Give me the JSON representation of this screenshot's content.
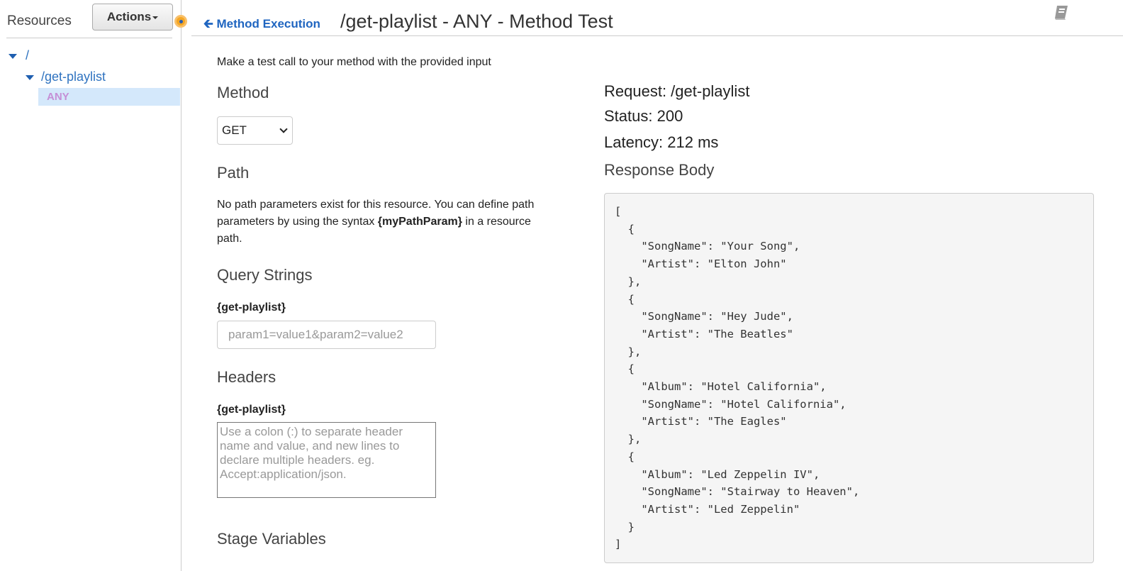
{
  "sidebar": {
    "title": "Resources",
    "actions_label": "Actions",
    "tree": [
      {
        "label": "/"
      },
      {
        "label": "/get-playlist"
      },
      {
        "label": "ANY"
      }
    ]
  },
  "header": {
    "back_label": "Method Execution",
    "title": "/get-playlist - ANY - Method Test",
    "icon": "book-icon"
  },
  "form": {
    "intro": "Make a test call to your method with the provided input",
    "method_heading": "Method",
    "method_value": "GET",
    "path_heading": "Path",
    "path_text_1": "No path parameters exist for this resource. You can define path parameters by using the syntax ",
    "path_text_bold": "{myPathParam}",
    "path_text_2": " in a resource path.",
    "query_heading": "Query Strings",
    "query_label": "{get-playlist}",
    "query_placeholder": "param1=value1&param2=value2",
    "headers_heading": "Headers",
    "headers_label": "{get-playlist}",
    "headers_placeholder": "Use a colon (:) to separate header name and value, and new lines to declare multiple headers. eg. Accept:application/json.",
    "stage_heading": "Stage Variables"
  },
  "response": {
    "request": "Request: /get-playlist",
    "status": "Status: 200",
    "latency": "Latency: 212 ms",
    "body_heading": "Response Body",
    "body": "[\n  {\n    \"SongName\": \"Your Song\",\n    \"Artist\": \"Elton John\"\n  },\n  {\n    \"SongName\": \"Hey Jude\",\n    \"Artist\": \"The Beatles\"\n  },\n  {\n    \"Album\": \"Hotel California\",\n    \"SongName\": \"Hotel California\",\n    \"Artist\": \"The Eagles\"\n  },\n  {\n    \"Album\": \"Led Zeppelin IV\",\n    \"SongName\": \"Stairway to Heaven\",\n    \"Artist\": \"Led Zeppelin\"\n  }\n]"
  }
}
